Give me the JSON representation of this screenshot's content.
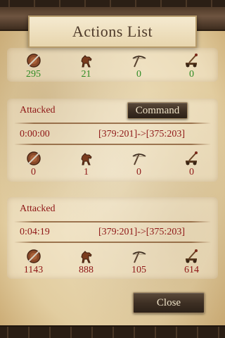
{
  "title": "Actions List",
  "summary": {
    "counts": [
      "295",
      "21",
      "0",
      "0"
    ]
  },
  "actions": [
    {
      "status": "Attacked",
      "command_label": "Command",
      "time": "0:00:00",
      "route": "[379:201]->[375:203]",
      "counts": [
        "0",
        "1",
        "0",
        "0"
      ]
    },
    {
      "status": "Attacked",
      "time": "0:04:19",
      "route": "[379:201]->[375:203]",
      "counts": [
        "1143",
        "888",
        "105",
        "614"
      ]
    }
  ],
  "close_label": "Close",
  "icons": [
    "warrior-shield-icon",
    "horse-icon",
    "crossbow-icon",
    "catapult-icon"
  ],
  "colors": {
    "summary_count": "#2d8a22",
    "action_text": "#8e1616",
    "title": "#4e3a2a"
  }
}
